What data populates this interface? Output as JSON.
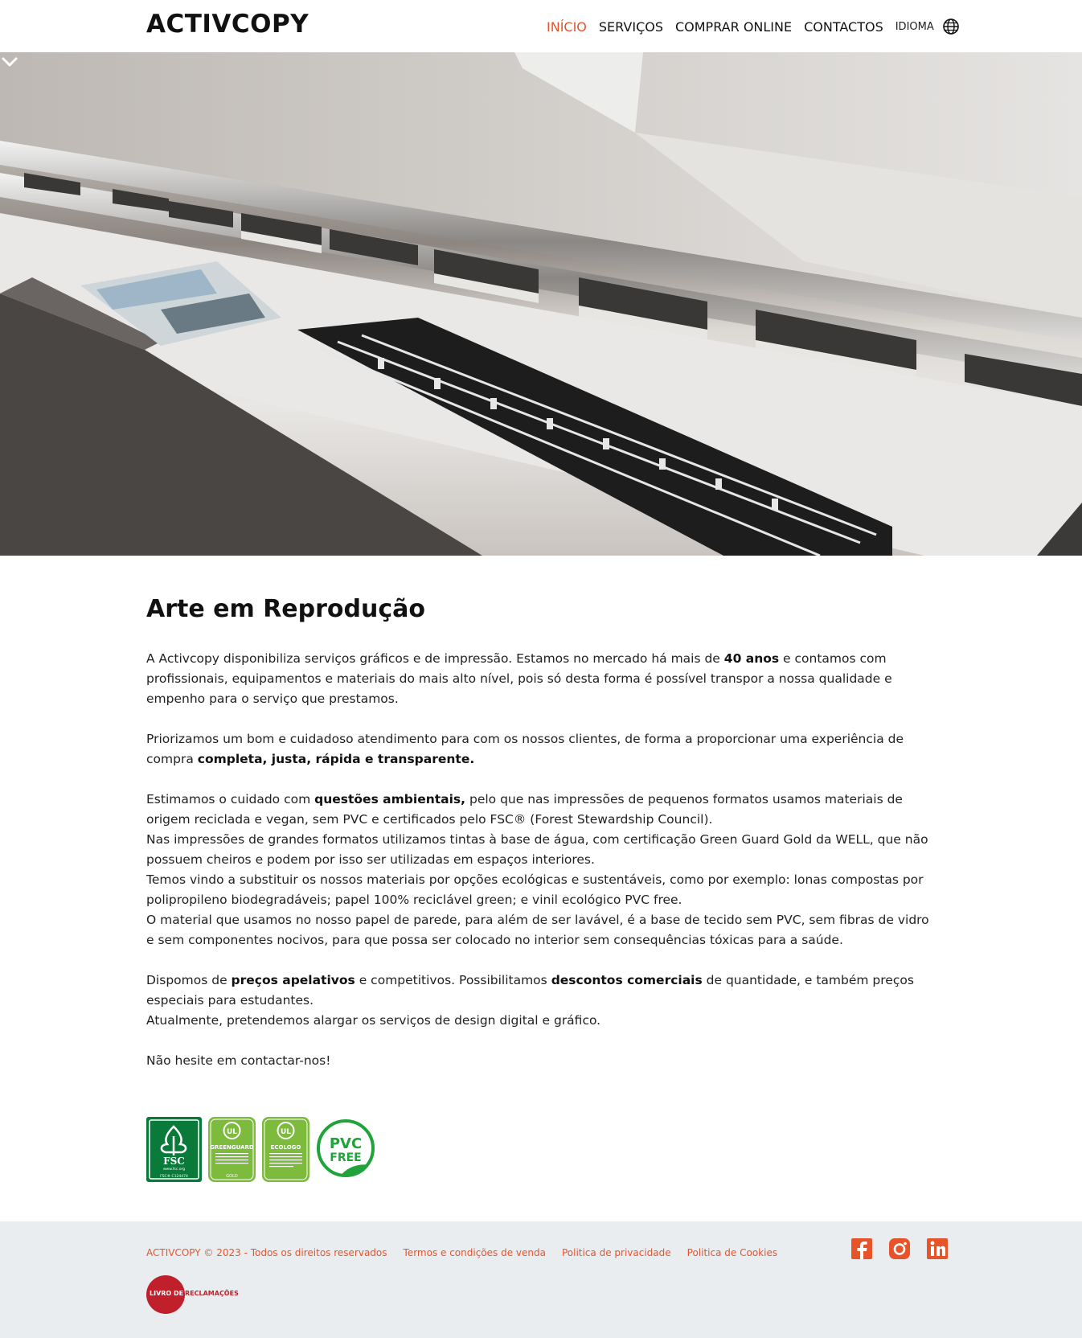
{
  "header": {
    "logo": "ACTIVCOPY",
    "nav": [
      {
        "label": "INÍCIO",
        "active": true
      },
      {
        "label": "SERVIÇOS",
        "active": false
      },
      {
        "label": "COMPRAR ONLINE",
        "active": false
      },
      {
        "label": "CONTACTOS",
        "active": false
      }
    ],
    "language_label": "IDIOMA",
    "language_icon": "globe-icon"
  },
  "hero": {
    "image": "wide-format-printer-photo",
    "scroll_icon": "chevron-down-icon"
  },
  "main": {
    "title": "Arte em Reprodução",
    "p1": {
      "a": "A Activcopy disponibiliza serviços gráficos e de impressão. Estamos no mercado há mais de ",
      "b": "40 anos",
      "c": " e contamos com profissionais, equipamentos e materiais do mais alto nível, pois só desta forma é possível transpor a nossa qualidade e empenho para o serviço que prestamos."
    },
    "p2": {
      "a": "Priorizamos um bom e cuidadoso atendimento para com os nossos clientes, de forma a proporcionar uma experiência de compra ",
      "b": "completa, justa, rápida e transparente."
    },
    "p3": {
      "a": "Estimamos o cuidado com ",
      "b": "questões ambientais,",
      "c": " pelo que nas impressões de pequenos formatos usamos materiais de origem reciclada e vegan, sem PVC e certificados pelo FSC® (Forest Stewardship Council)."
    },
    "p4": "Nas impressões de grandes formatos utilizamos tintas à base de água, com certificação Green Guard Gold da WELL, que não possuem cheiros e podem por isso ser utilizadas em espaços interiores.",
    "p5": "Temos vindo a substituir os nossos materiais por opções ecológicas e sustentáveis, como por exemplo: lonas compostas por polipropileno biodegradáveis; papel 100% reciclável green; e vinil ecológico PVC free.",
    "p6": "O material que usamos no nosso papel de parede, para além de ser lavável, é a base de tecido sem PVC, sem fibras de vidro e sem componentes nocivos, para que possa ser colocado no interior sem consequências tóxicas para a saúde.",
    "p7": {
      "a": "Dispomos de ",
      "b": "preços apelativos",
      "c": " e competitivos. Possibilitamos ",
      "d": "descontos comerciais",
      "e": " de quantidade, e também preços especiais para estudantes."
    },
    "p8": "Atualmente, pretendemos alargar os serviços de design digital e gráfico.",
    "p9": "Não hesite em contactar-nos!"
  },
  "badges": {
    "fsc": {
      "title": "FSC",
      "url": "www.fsc.org",
      "code": "FSC® C124474",
      "color": "#0a7a3a"
    },
    "greenguard": {
      "ul": "UL",
      "title": "GREENGUARD",
      "sub": "GOLD",
      "color": "#7dbb3c"
    },
    "ecologo": {
      "ul": "UL",
      "title": "ECOLOGO",
      "color": "#7dbb3c"
    },
    "pvc": {
      "line1": "PVC",
      "line2": "FREE",
      "color": "#1fa33a"
    }
  },
  "footer": {
    "copyright": "ACTIVCOPY © 2023 - Todos os direitos reservados",
    "links": [
      "Termos e condições de venda",
      "Politica de privacidade",
      "Politica de Cookies"
    ],
    "social": [
      "facebook-icon",
      "instagram-icon",
      "linkedin-icon"
    ],
    "livro_a": "LIVRO DE",
    "livro_b": "RECLAMAÇÕES",
    "accent": "#e8542a"
  }
}
